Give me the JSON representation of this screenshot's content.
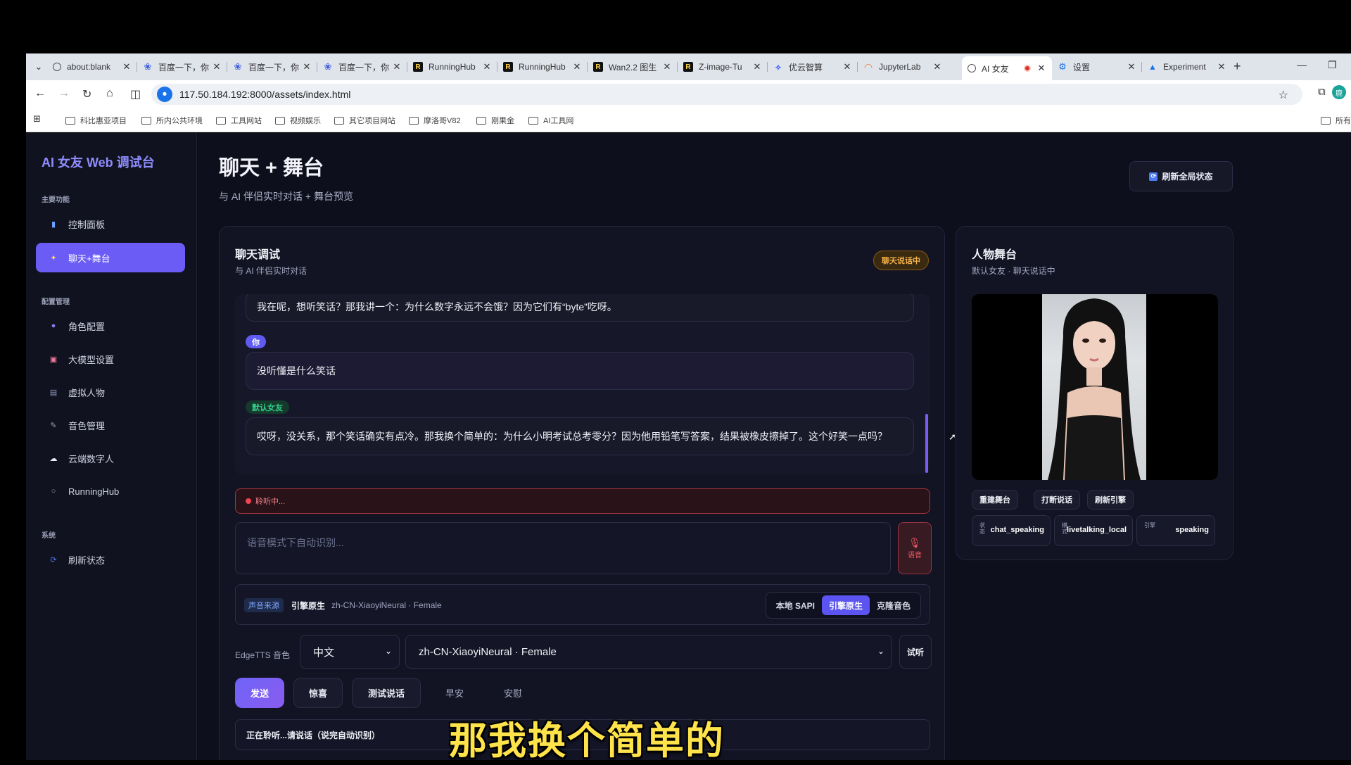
{
  "browser": {
    "tabs": [
      {
        "title": "about:blank",
        "icon": "globe"
      },
      {
        "title": "百度一下，你",
        "icon": "baidu"
      },
      {
        "title": "百度一下，你",
        "icon": "baidu"
      },
      {
        "title": "百度一下，你",
        "icon": "baidu"
      },
      {
        "title": "RunningHub",
        "icon": "runninghub"
      },
      {
        "title": "RunningHub",
        "icon": "runninghub"
      },
      {
        "title": "Wan2.2 图生",
        "icon": "runninghub"
      },
      {
        "title": "Z-image-Tu",
        "icon": "runninghub"
      },
      {
        "title": "优云智算",
        "icon": "youyun"
      },
      {
        "title": "JupyterLab",
        "icon": "jupyter"
      },
      {
        "title": "AI 女友",
        "icon": "globe"
      },
      {
        "title": "设置",
        "icon": "gear"
      },
      {
        "title": "Experiment",
        "icon": "experiment"
      }
    ],
    "url": "117.50.184.192:8000/assets/index.html",
    "bookmarks": [
      "科比惠亚项目",
      "所内公共环境",
      "工具网站",
      "视频娱乐",
      "其它项目网站",
      "摩洛哥V82",
      "刚果金",
      "AI工具网"
    ],
    "bookmarks_right": "所有"
  },
  "sidebar": {
    "brand": "AI 女友 Web 调试台",
    "sections": [
      {
        "label": "主要功能",
        "items": [
          {
            "label": "控制面板",
            "icon": "chart-icon"
          },
          {
            "label": "聊天+舞台",
            "icon": "stage-icon",
            "active": true
          }
        ]
      },
      {
        "label": "配置管理",
        "items": [
          {
            "label": "角色配置",
            "icon": "person-icon"
          },
          {
            "label": "大模型设置",
            "icon": "robot-icon"
          },
          {
            "label": "虚拟人物",
            "icon": "clapper-icon"
          },
          {
            "label": "音色管理",
            "icon": "mic-icon"
          },
          {
            "label": "云端数字人",
            "icon": "cloud-icon"
          },
          {
            "label": "RunningHub",
            "icon": "circle-icon"
          }
        ]
      },
      {
        "label": "系统",
        "items": [
          {
            "label": "刷新状态",
            "icon": "refresh-icon"
          }
        ]
      }
    ]
  },
  "header": {
    "title": "聊天 + 舞台",
    "subtitle": "与 AI 伴侣实时对话 + 舞台预览",
    "refresh_label": "刷新全局状态"
  },
  "chat": {
    "title": "聊天调试",
    "subtitle": "与 AI 伴侣实时对话",
    "status": "聊天说话中",
    "messages": [
      {
        "who": "",
        "role": "ai",
        "text": "我在呢，想听笑话？那我讲一个：为什么数字永远不会饿？因为它们有“byte”吃呀。"
      },
      {
        "who": "你",
        "role": "me",
        "text": "没听懂是什么笑话"
      },
      {
        "who": "默认女友",
        "role": "ai",
        "text": "哎呀，没关系，那个笑话确实有点冷。那我换个简单的：为什么小明考试总考零分？因为他用铅笔写答案，结果被橡皮擦掉了。这个好笑一点吗？"
      }
    ],
    "listening": "聆听中...",
    "input_placeholder": "语音模式下自动识别...",
    "voice_button": "语音",
    "voice_source": {
      "tag": "声音来源",
      "engine": "引擎原生",
      "voice": "zh-CN-XiaoyiNeural · Female",
      "options": [
        "本地 SAPI",
        "引擎原生",
        "克隆音色"
      ],
      "selected": "引擎原生"
    },
    "tts": {
      "label": "EdgeTTS 音色",
      "language": "中文",
      "voice": "zh-CN-XiaoyiNeural · Female",
      "try_label": "试听"
    },
    "actions": [
      "发送",
      "惊喜",
      "测试说话",
      "早安",
      "安慰"
    ],
    "status_line": "正在聆听...请说话（说完自动识别）"
  },
  "stage": {
    "title": "人物舞台",
    "subtitle": "默认女友 · 聊天说话中",
    "buttons": [
      "重建舞台",
      "打断说话",
      "刷新引擎"
    ],
    "stats": [
      {
        "key": "状态",
        "value": "chat_speaking"
      },
      {
        "key": "模式",
        "value": "livetalking_local"
      },
      {
        "key": "引擎",
        "value": "speaking"
      }
    ]
  },
  "caption": "那我换个简单的"
}
